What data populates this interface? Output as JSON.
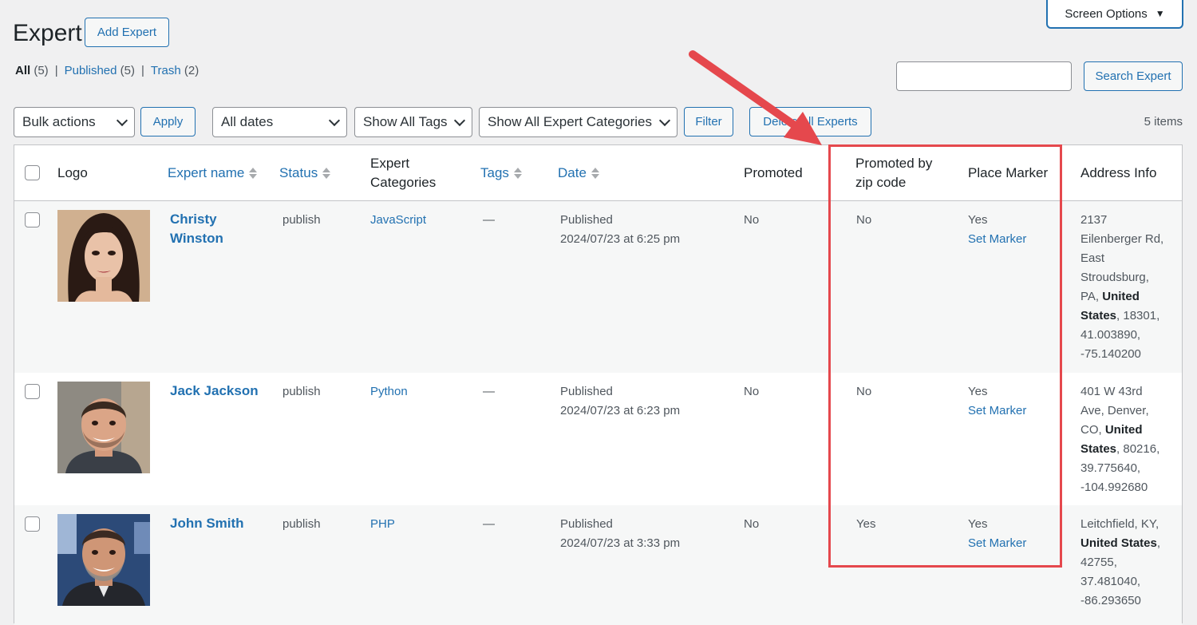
{
  "header": {
    "screen_options": "Screen Options",
    "title": "Expert",
    "add_button": "Add Expert"
  },
  "views": {
    "all": {
      "label": "All",
      "count": "(5)"
    },
    "published": {
      "label": "Published",
      "count": "(5)"
    },
    "trash": {
      "label": "Trash",
      "count": "(2)"
    },
    "separator": "|"
  },
  "search": {
    "value": "",
    "button": "Search Expert"
  },
  "tablenav": {
    "bulk_actions": "Bulk actions",
    "apply": "Apply",
    "dates": "All dates",
    "tags": "Show All Tags",
    "categories": "Show All Expert Categories",
    "filter": "Filter",
    "delete_all": "Delete All Experts",
    "items": "5 items"
  },
  "columns": {
    "logo": "Logo",
    "expert_name": "Expert name",
    "status": "Status",
    "categories_line1": "Expert",
    "categories_line2": "Categories",
    "tags": "Tags",
    "date": "Date",
    "promoted": "Promoted",
    "promoted_zip_line1": "Promoted by",
    "promoted_zip_line2": "zip code",
    "place_marker": "Place Marker",
    "address": "Address Info"
  },
  "rows": [
    {
      "name_line1": "Christy",
      "name_line2": "Winston",
      "status": "publish",
      "category": "JavaScript",
      "tags": "—",
      "date_status": "Published",
      "date": "2024/07/23 at 6:25 pm",
      "promoted": "No",
      "promoted_zip": "No",
      "marker": "Yes",
      "marker_link": "Set Marker",
      "addr": {
        "l1": "2137",
        "l2": "Eilenberger Rd,",
        "l3": "East",
        "l4": "Stroudsburg,",
        "l5a": "PA,",
        "l5b": "United",
        "l6a": "States",
        "l6b": ", 18301,",
        "l7": "41.003890,",
        "l8": "-75.140200"
      }
    },
    {
      "name_line1": "Jack Jackson",
      "status": "publish",
      "category": "Python",
      "tags": "—",
      "date_status": "Published",
      "date": "2024/07/23 at 6:23 pm",
      "promoted": "No",
      "promoted_zip": "No",
      "marker": "Yes",
      "marker_link": "Set Marker",
      "addr": {
        "l1": "401 W 43rd",
        "l2": "Ave, Denver,",
        "l3a": "CO,",
        "l3b": "United",
        "l4a": "States",
        "l4b": ", 80216,",
        "l5": "39.775640,",
        "l6": "-104.992680"
      }
    },
    {
      "name_line1": "John Smith",
      "status": "publish",
      "category": "PHP",
      "tags": "—",
      "date_status": "Published",
      "date": "2024/07/23 at 3:33 pm",
      "promoted": "No",
      "promoted_zip": "Yes",
      "marker": "Yes",
      "marker_link": "Set Marker",
      "addr": {
        "l1": "Leitchfield, KY,",
        "l2a": "United States",
        "l2b": ",",
        "l3": "42755,",
        "l4": "37.481040,",
        "l5": "-86.293650"
      }
    }
  ],
  "colors": {
    "accent": "#2271b1",
    "annotation": "#e5484d",
    "background": "#f0f0f1"
  }
}
